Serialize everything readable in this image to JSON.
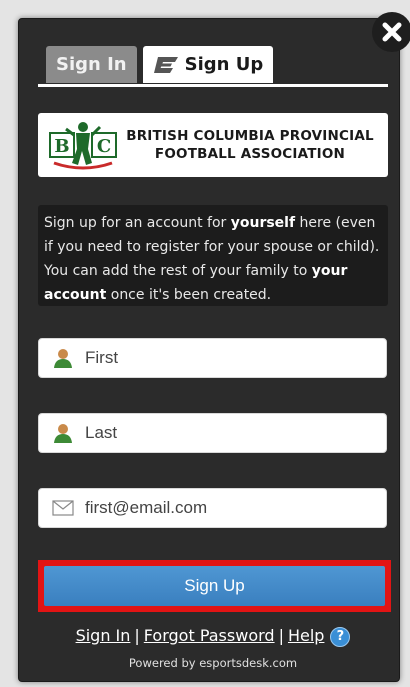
{
  "tabs": [
    {
      "label": "Sign In",
      "active": false
    },
    {
      "label": "Sign Up",
      "active": true
    }
  ],
  "org": {
    "logo_letters": [
      "B",
      "C"
    ],
    "name_line1": "BRITISH COLUMBIA PROVINCIAL",
    "name_line2": "FOOTBALL ASSOCIATION"
  },
  "info": {
    "t1": "Sign up for an account for ",
    "b1": "yourself",
    "t2": " here (even if you need to register for your spouse or child). You can add the rest of your family to ",
    "b2": "your account",
    "t3": " once it's been created."
  },
  "form": {
    "first_placeholder": "First",
    "last_placeholder": "Last",
    "email_placeholder": "first@email.com",
    "submit_label": "Sign Up"
  },
  "footer": {
    "signin_link": "Sign In",
    "sep1": "|",
    "forgot_link": "Forgot Password",
    "sep2": "|",
    "help_link": "Help",
    "help_icon_glyph": "?",
    "powered": "Powered by esportsdesk.com"
  },
  "colors": {
    "panel_bg": "#2b2b2b",
    "button_blue": "#3a7fbf",
    "highlight_red": "#e21414"
  }
}
